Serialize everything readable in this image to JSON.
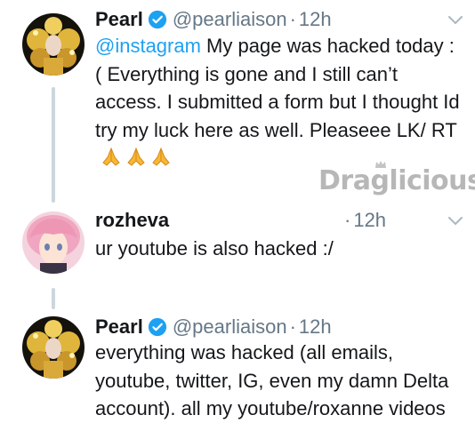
{
  "tweets": [
    {
      "name": "Pearl",
      "handle": "@pearliaison",
      "time": "12h",
      "mention": "@instagram",
      "text": " My page was hacked today : ( Everything is gone and I still can’t access. I submitted a form but I thought Id try my luck here as well. Pleaseee LK/ RT",
      "emoji": [
        "folded-hands",
        "folded-hands",
        "folded-hands"
      ]
    },
    {
      "name": "rozheva",
      "time": "12h",
      "text": "ur youtube is also hacked :/"
    },
    {
      "name": "Pearl",
      "handle": "@pearliaison",
      "time": "12h",
      "text": "everything was hacked (all emails, youtube, twitter, IG, even my damn Delta account). all my youtube/roxanne videos"
    }
  ],
  "separator": "·",
  "watermark": "Draglicious",
  "icons": {
    "verified": "verified-badge-icon",
    "menu": "chevron-down-icon",
    "emoji": "folded-hands-emoji"
  },
  "colors": {
    "accent": "#1da1f2",
    "muted": "#657786",
    "text": "#14171a",
    "thread_line": "#ccd6dd"
  }
}
